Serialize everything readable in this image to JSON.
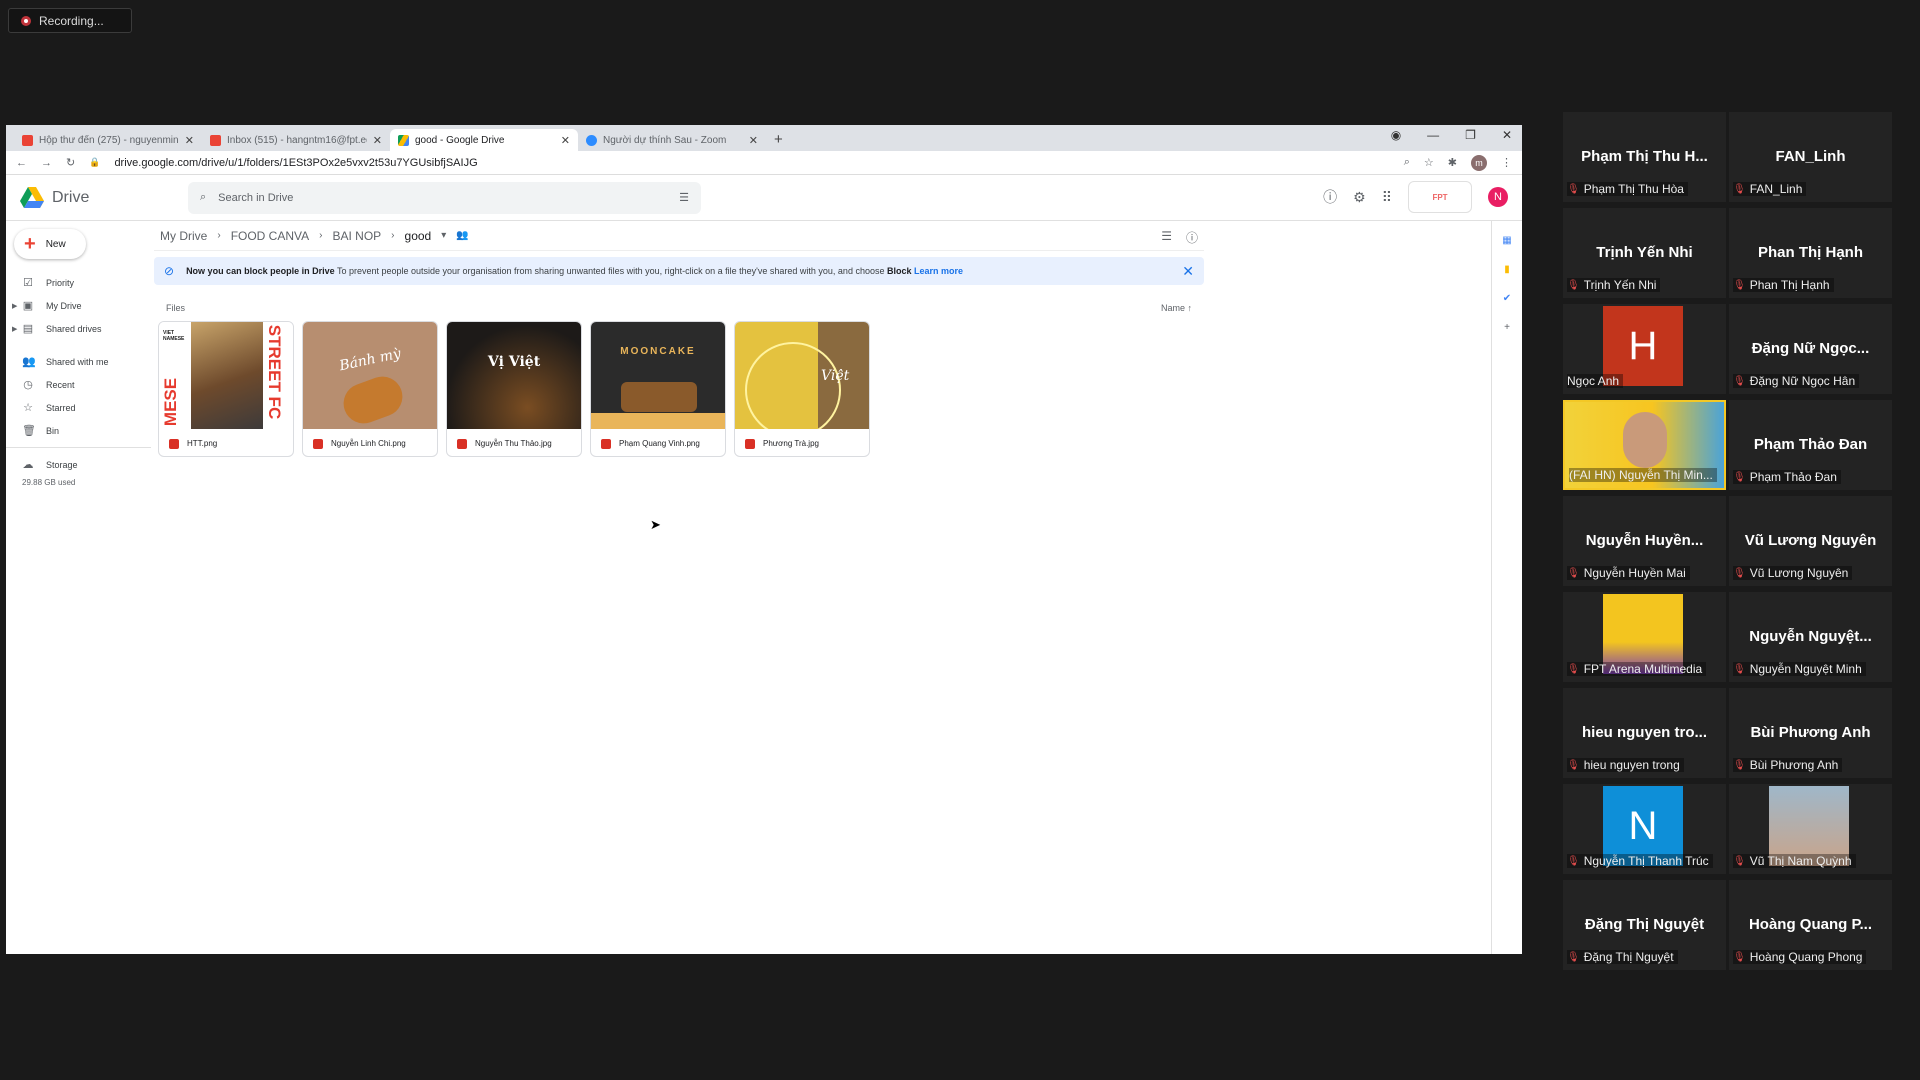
{
  "recording": {
    "label": "Recording..."
  },
  "browser": {
    "tabs": [
      {
        "title": "Hộp thư đến (275) - nguyenminh",
        "icon": "gmail-icon",
        "active": false
      },
      {
        "title": "Inbox (515) - hangntm16@fpt.edu",
        "icon": "gmail-icon",
        "active": false
      },
      {
        "title": "good - Google Drive",
        "icon": "drive-icon",
        "active": true
      },
      {
        "title": "Người dự thính Sau - Zoom",
        "icon": "zoom-icon",
        "active": false
      }
    ],
    "url": "drive.google.com/drive/u/1/folders/1ESt3POx2e5vxv2t53u7YGUsibfjSAIJG"
  },
  "drive": {
    "app_name": "Drive",
    "search_placeholder": "Search in Drive",
    "user_initial": "N",
    "nav": {
      "new_label": "New",
      "items": [
        "Priority",
        "My Drive",
        "Shared drives",
        "Shared with me",
        "Recent",
        "Starred",
        "Bin",
        "Storage"
      ],
      "storage_used": "29.88 GB used"
    },
    "breadcrumb": [
      "My Drive",
      "FOOD CANVA",
      "BAI NOP",
      "good"
    ],
    "banner": {
      "bold": "Now you can block people in Drive",
      "text": "To prevent people outside your organisation from sharing unwanted files with you, right-click on a file they've shared with you, and choose",
      "block": "Block",
      "link": "Learn more"
    },
    "files_label": "Files",
    "sort_label": "Name",
    "files": [
      {
        "name": "HTT.png"
      },
      {
        "name": "Nguyễn Linh Chi.png",
        "thumb_text": "Bánh mỳ"
      },
      {
        "name": "Nguyễn Thu Thảo.jpg",
        "thumb_text": "Vị Việt"
      },
      {
        "name": "Phạm Quang Vinh.png",
        "thumb_text": "MOONCAKE"
      },
      {
        "name": "Phương Trà.jpg",
        "thumb_text": "Việt"
      }
    ],
    "thumb_texts": {
      "htt_side": "STREET FC",
      "htt_bottom": "MESE",
      "htt_corner": "VIET NAMESE"
    }
  },
  "participants": [
    {
      "big": "Phạm Thị Thu H...",
      "name": "Phạm Thị Thu Hòa"
    },
    {
      "big": "FAN_Linh",
      "name": "FAN_Linh"
    },
    {
      "big": "Trịnh Yến Nhi",
      "name": "Trịnh Yến Nhi"
    },
    {
      "big": "Phan Thị Hạnh",
      "name": "Phan Thị Hạnh"
    },
    {
      "avatar": "H",
      "avatar_color": "#c2351c",
      "name": "Ngọc Anh"
    },
    {
      "big": "Đặng Nữ Ngọc...",
      "name": "Đặng Nữ Ngọc Hân"
    },
    {
      "video": true,
      "name": "(FAI HN) Nguyễn Thị Min..."
    },
    {
      "big": "Phạm Thảo Đan",
      "name": "Phạm Thảo Đan"
    },
    {
      "big": "Nguyễn Huyền...",
      "name": "Nguyễn Huyền Mai"
    },
    {
      "big": "Vũ Lương Nguyên",
      "name": "Vũ Lương Nguyên"
    },
    {
      "poster": true,
      "name": "FPT Arena Multimedia"
    },
    {
      "big": "Nguyễn Nguyệt...",
      "name": "Nguyễn Nguyệt Minh"
    },
    {
      "big": "hieu nguyen tro...",
      "name": "hieu nguyen trong"
    },
    {
      "big": "Bùi Phương Anh",
      "name": "Bùi Phương Anh"
    },
    {
      "avatar": "N",
      "avatar_color": "#0e8fd8",
      "name": "Nguyễn Thị Thanh Trúc"
    },
    {
      "photo": true,
      "name": "Vũ Thị Nam Quỳnh"
    },
    {
      "big": "Đặng Thị Nguyệt",
      "name": "Đặng Thị Nguyệt"
    },
    {
      "big": "Hoàng Quang P...",
      "name": "Hoàng Quang Phong"
    }
  ]
}
